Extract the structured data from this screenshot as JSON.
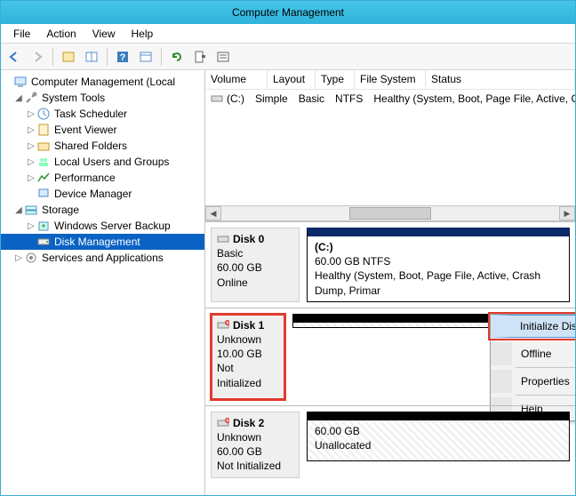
{
  "window": {
    "title": "Computer Management"
  },
  "menus": {
    "file": "File",
    "action": "Action",
    "view": "View",
    "help": "Help"
  },
  "tree": {
    "root": "Computer Management (Local",
    "system_tools": "System Tools",
    "task_scheduler": "Task Scheduler",
    "event_viewer": "Event Viewer",
    "shared_folders": "Shared Folders",
    "local_users": "Local Users and Groups",
    "performance": "Performance",
    "device_manager": "Device Manager",
    "storage": "Storage",
    "wsb": "Windows Server Backup",
    "disk_mgmt": "Disk Management",
    "services": "Services and Applications"
  },
  "columns": {
    "volume": "Volume",
    "layout": "Layout",
    "type": "Type",
    "fs": "File System",
    "status": "Status"
  },
  "vol_row": {
    "drive": "(C:)",
    "layout": "Simple",
    "type": "Basic",
    "fs": "NTFS",
    "status": "Healthy (System, Boot, Page File, Active, Cr"
  },
  "disks": {
    "d0": {
      "name": "Disk 0",
      "type": "Basic",
      "size": "60.00 GB",
      "state": "Online",
      "vol": {
        "label": "(C:)",
        "detail": "60.00 GB NTFS",
        "status": "Healthy (System, Boot, Page File, Active, Crash Dump, Primar"
      }
    },
    "d1": {
      "name": "Disk 1",
      "type": "Unknown",
      "size": "10.00 GB",
      "state": "Not Initialized"
    },
    "d2": {
      "name": "Disk 2",
      "type": "Unknown",
      "size": "60.00 GB",
      "state": "Not Initialized",
      "vol": {
        "detail": "60.00 GB",
        "status": "Unallocated"
      }
    }
  },
  "ctx": {
    "init": "Initialize Disk",
    "offline": "Offline",
    "props": "Properties",
    "help": "Help"
  }
}
